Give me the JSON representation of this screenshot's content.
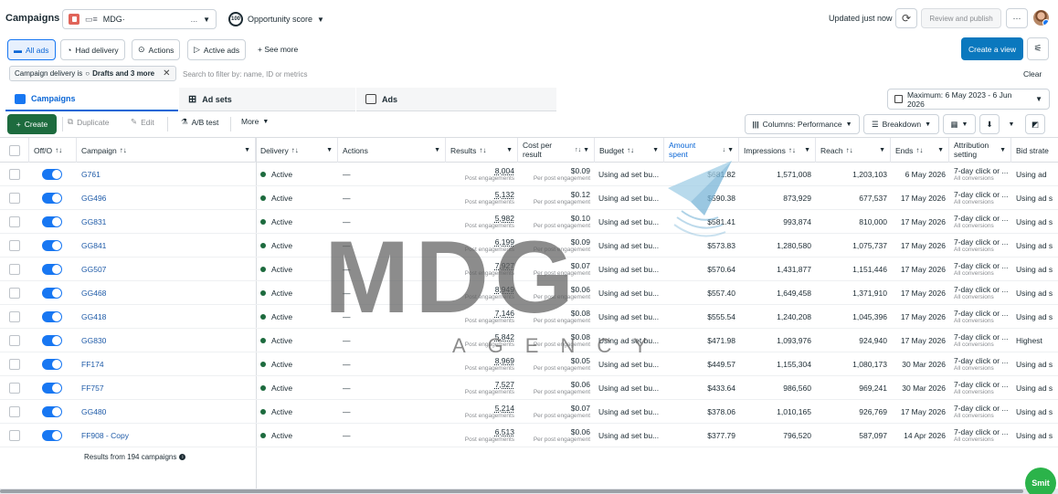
{
  "header": {
    "title": "Campaigns",
    "account": "MDG·",
    "account_ellipsis": "...",
    "opportunity_value": "100",
    "opportunity_label": "Opportunity score",
    "updated": "Updated just now",
    "review_publish": "Review and publish",
    "more": "···"
  },
  "filters": {
    "chips": [
      "All ads",
      "Had delivery",
      "Actions",
      "Active ads"
    ],
    "see_more": "See more",
    "create_view": "Create a view"
  },
  "search": {
    "pill_prefix": "Campaign delivery is",
    "pill_values": "Drafts and 3 more",
    "placeholder": "Search to filter by: name, ID or metrics",
    "clear": "Clear"
  },
  "tabs": [
    "Campaigns",
    "Ad sets",
    "Ads"
  ],
  "date_range": "Maximum: 6 May 2023 - 6 Jun 2026",
  "toolbar": {
    "create": "Create",
    "duplicate": "Duplicate",
    "edit": "Edit",
    "ab_test": "A/B test",
    "more": "More",
    "columns": "Columns: Performance",
    "breakdown": "Breakdown"
  },
  "columns": {
    "off_on": "Off/O",
    "campaign": "Campaign",
    "delivery": "Delivery",
    "actions": "Actions",
    "results": "Results",
    "cost_per_result_1": "Cost per",
    "cost_per_result_2": "result",
    "budget": "Budget",
    "amount_spent_1": "Amount",
    "amount_spent_2": "spent",
    "impressions": "Impressions",
    "reach": "Reach",
    "ends": "Ends",
    "attribution_1": "Attribution",
    "attribution_2": "setting",
    "bid_strategy": "Bid strate"
  },
  "rows": [
    {
      "campaign": "G761",
      "delivery": "Active",
      "actions": "—",
      "results": "8,004",
      "results_sub": "Post engagements",
      "cpr": "$0.09",
      "cpr_sub": "Per post engagement",
      "budget": "Using ad set bu...",
      "spent": "$681.82",
      "impressions": "1,571,008",
      "reach": "1,203,103",
      "ends": "6 May 2026",
      "attr": "7-day click or ...",
      "attr_sub": "All conversions",
      "bid": "Using ad"
    },
    {
      "campaign": "GG496",
      "delivery": "Active",
      "actions": "—",
      "results": "5,132",
      "results_sub": "Post engagements",
      "cpr": "$0.12",
      "cpr_sub": "Per post engagement",
      "budget": "Using ad set bu...",
      "spent": "$590.38",
      "impressions": "873,929",
      "reach": "677,537",
      "ends": "17 May 2026",
      "attr": "7-day click or ...",
      "attr_sub": "All conversions",
      "bid": "Using ad s"
    },
    {
      "campaign": "GG831",
      "delivery": "Active",
      "actions": "—",
      "results": "5,982",
      "results_sub": "Post engagements",
      "cpr": "$0.10",
      "cpr_sub": "Per post engagement",
      "budget": "Using ad set bu...",
      "spent": "$581.41",
      "impressions": "993,874",
      "reach": "810,000",
      "ends": "17 May 2026",
      "attr": "7-day click or ...",
      "attr_sub": "All conversions",
      "bid": "Using ad s"
    },
    {
      "campaign": "GG841",
      "delivery": "Active",
      "actions": "—",
      "results": "6,199",
      "results_sub": "Post engagements",
      "cpr": "$0.09",
      "cpr_sub": "Per post engagement",
      "budget": "Using ad set bu...",
      "spent": "$573.83",
      "impressions": "1,280,580",
      "reach": "1,075,737",
      "ends": "17 May 2026",
      "attr": "7-day click or ...",
      "attr_sub": "All conversions",
      "bid": "Using ad s"
    },
    {
      "campaign": "GG507",
      "delivery": "Active",
      "actions": "—",
      "results": "7,927",
      "results_sub": "Post engagements",
      "cpr": "$0.07",
      "cpr_sub": "Per post engagement",
      "budget": "Using ad set bu...",
      "spent": "$570.64",
      "impressions": "1,431,877",
      "reach": "1,151,446",
      "ends": "17 May 2026",
      "attr": "7-day click or ...",
      "attr_sub": "All conversions",
      "bid": "Using ad s"
    },
    {
      "campaign": "GG468",
      "delivery": "Active",
      "actions": "—",
      "results": "8,949",
      "results_sub": "Post engagements",
      "cpr": "$0.06",
      "cpr_sub": "Per post engagement",
      "budget": "Using ad set bu...",
      "spent": "$557.40",
      "impressions": "1,649,458",
      "reach": "1,371,910",
      "ends": "17 May 2026",
      "attr": "7-day click or ...",
      "attr_sub": "All conversions",
      "bid": "Using ad s"
    },
    {
      "campaign": "GG418",
      "delivery": "Active",
      "actions": "—",
      "results": "7,146",
      "results_sub": "Post engagements",
      "cpr": "$0.08",
      "cpr_sub": "Per post engagement",
      "budget": "Using ad set bu...",
      "spent": "$555.54",
      "impressions": "1,240,208",
      "reach": "1,045,396",
      "ends": "17 May 2026",
      "attr": "7-day click or ...",
      "attr_sub": "All conversions",
      "bid": "Using ad s"
    },
    {
      "campaign": "GG830",
      "delivery": "Active",
      "actions": "—",
      "results": "5,842",
      "results_sub": "Post engagements",
      "cpr": "$0.08",
      "cpr_sub": "Per post engagement",
      "budget": "Using ad set bu...",
      "spent": "$471.98",
      "impressions": "1,093,976",
      "reach": "924,940",
      "ends": "17 May 2026",
      "attr": "7-day click or ...",
      "attr_sub": "All conversions",
      "bid": "Highest"
    },
    {
      "campaign": "FF174",
      "delivery": "Active",
      "actions": "—",
      "results": "8,969",
      "results_sub": "Post engagements",
      "cpr": "$0.05",
      "cpr_sub": "Per post engagement",
      "budget": "Using ad set bu...",
      "spent": "$449.57",
      "impressions": "1,155,304",
      "reach": "1,080,173",
      "ends": "30 Mar 2026",
      "attr": "7-day click or ...",
      "attr_sub": "All conversions",
      "bid": "Using ad s"
    },
    {
      "campaign": "FF757",
      "delivery": "Active",
      "actions": "—",
      "results": "7,527",
      "results_sub": "Post engagements",
      "cpr": "$0.06",
      "cpr_sub": "Per post engagement",
      "budget": "Using ad set bu...",
      "spent": "$433.64",
      "impressions": "986,560",
      "reach": "969,241",
      "ends": "30 Mar 2026",
      "attr": "7-day click or ...",
      "attr_sub": "All conversions",
      "bid": "Using ad s"
    },
    {
      "campaign": "GG480",
      "delivery": "Active",
      "actions": "—",
      "results": "5,214",
      "results_sub": "Post engagements",
      "cpr": "$0.07",
      "cpr_sub": "Per post engagement",
      "budget": "Using ad set bu...",
      "spent": "$378.06",
      "impressions": "1,010,165",
      "reach": "926,769",
      "ends": "17 May 2026",
      "attr": "7-day click or ...",
      "attr_sub": "All conversions",
      "bid": "Using ad s"
    },
    {
      "campaign": "FF908 - Copy",
      "delivery": "Active",
      "actions": "—",
      "results": "6,513",
      "results_sub": "Post engagements",
      "cpr": "$0.06",
      "cpr_sub": "Per post engagement",
      "budget": "Using ad set bu...",
      "spent": "$377.79",
      "impressions": "796,520",
      "reach": "587,097",
      "ends": "14 Apr 2026",
      "attr": "7-day click or ...",
      "attr_sub": "All conversions",
      "bid": "Using ad s"
    }
  ],
  "footer": {
    "results_from": "Results from 194 campaigns"
  },
  "watermark": {
    "main": "MDG",
    "sub": "AGENCY"
  },
  "floating_button": "Smit",
  "colors": {
    "primary_blue": "#0a78be",
    "link_blue": "#1f5ba8",
    "create_green": "#1d6b3e",
    "toggle_blue": "#1877f2"
  }
}
